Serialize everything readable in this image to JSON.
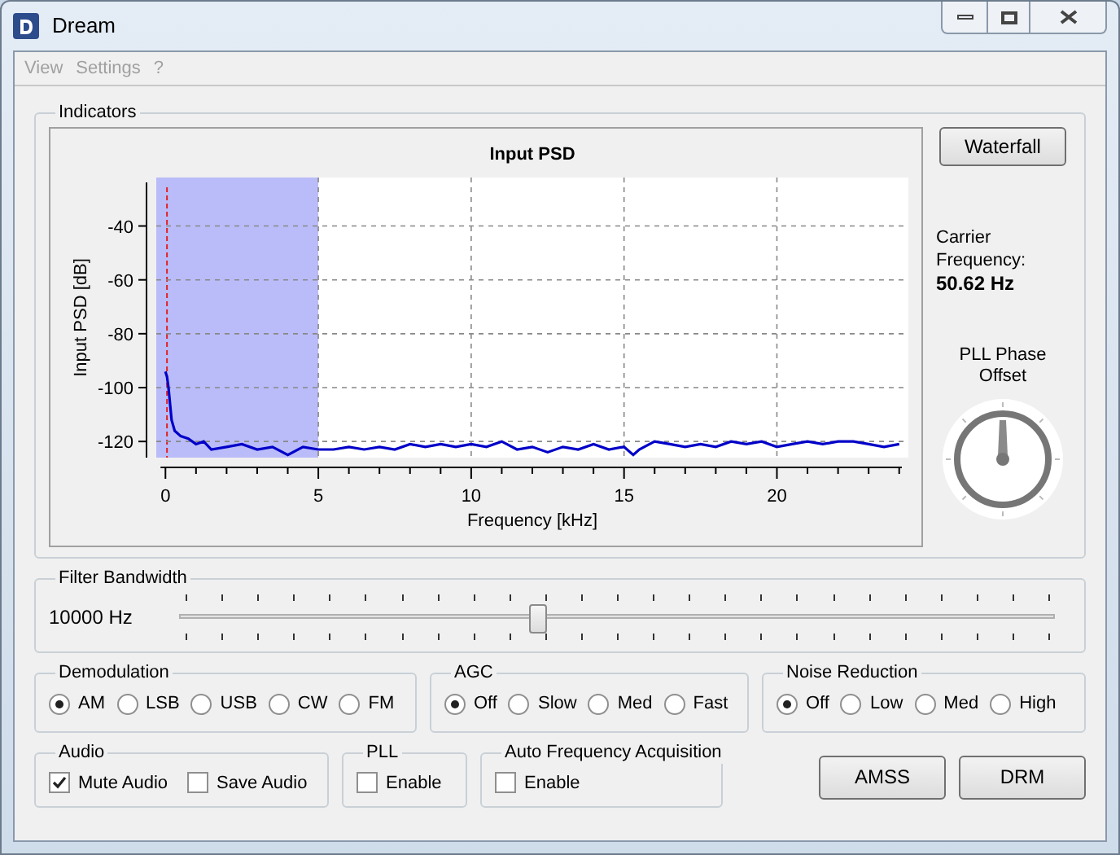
{
  "window": {
    "title": "Dream"
  },
  "menu": [
    {
      "label": "View",
      "disabled": true
    },
    {
      "label": "Settings",
      "disabled": true
    },
    {
      "label": "?",
      "disabled": true
    }
  ],
  "indicators": {
    "label": "Indicators",
    "chart_data": {
      "type": "line",
      "title": "Input PSD",
      "xlabel": "Frequency [kHz]",
      "ylabel": "Input PSD [dB]",
      "xlim": [
        -0.3,
        24.3
      ],
      "ylim": [
        -126,
        -22
      ],
      "xticks": [
        0,
        5,
        10,
        15,
        20
      ],
      "yticks": [
        -40,
        -60,
        -80,
        -100,
        -120
      ],
      "x": [
        0,
        0.05,
        0.1,
        0.2,
        0.3,
        0.5,
        0.75,
        1,
        1.25,
        1.5,
        2,
        2.5,
        3,
        3.5,
        4,
        4.5,
        5,
        5.5,
        6,
        6.5,
        7,
        7.5,
        8,
        8.5,
        9,
        9.5,
        10,
        10.5,
        11,
        11.5,
        12,
        12.5,
        13,
        13.5,
        14,
        14.5,
        15,
        15.3,
        15.5,
        16,
        16.5,
        17,
        17.5,
        18,
        18.5,
        19,
        19.5,
        20,
        20.5,
        21,
        21.5,
        22,
        22.5,
        23,
        23.5,
        24
      ],
      "grid": true,
      "bands": [
        {
          "axis": "x",
          "from": -0.3,
          "to": 5,
          "color": "#babcf9"
        }
      ],
      "ref_lines": [
        {
          "axis": "x",
          "value": 0.05,
          "color": "#e02020"
        }
      ],
      "series": [
        {
          "color": "#0000c8",
          "values": [
            -94,
            -96,
            -100,
            -112,
            -116,
            -118,
            -119,
            -121,
            -120,
            -123,
            -122,
            -121,
            -123,
            -122,
            -125,
            -122,
            -123,
            -123,
            -122,
            -123,
            -122,
            -123,
            -121,
            -122,
            -121,
            -122,
            -121,
            -122,
            -120,
            -123,
            -122,
            -124,
            -122,
            -123,
            -121,
            -123,
            -122,
            -125,
            -123,
            -120,
            -121,
            -122,
            -121,
            -122,
            -120,
            -121,
            -120,
            -122,
            -121,
            -120,
            -121,
            -120,
            -120,
            -121,
            -122,
            -121
          ]
        }
      ]
    },
    "waterfall_button": "Waterfall",
    "carrier_label": "Carrier Frequency:",
    "carrier_value": "50.62 Hz",
    "pll_label": "PLL Phase Offset"
  },
  "filter": {
    "label": "Filter Bandwidth",
    "reading": "10000 Hz",
    "level": 0.41
  },
  "demodulation": {
    "label": "Demodulation",
    "options": [
      {
        "label": "AM",
        "selected": true
      },
      {
        "label": "LSB",
        "selected": false
      },
      {
        "label": "USB",
        "selected": false
      },
      {
        "label": "CW",
        "selected": false
      },
      {
        "label": "FM",
        "selected": false
      }
    ]
  },
  "agc": {
    "label": "AGC",
    "options": [
      {
        "label": "Off",
        "selected": true
      },
      {
        "label": "Slow",
        "selected": false
      },
      {
        "label": "Med",
        "selected": false
      },
      {
        "label": "Fast",
        "selected": false
      }
    ]
  },
  "noise_reduction": {
    "label": "Noise Reduction",
    "options": [
      {
        "label": "Off",
        "selected": true
      },
      {
        "label": "Low",
        "selected": false
      },
      {
        "label": "Med",
        "selected": false
      },
      {
        "label": "High",
        "selected": false
      }
    ]
  },
  "audio": {
    "label": "Audio",
    "options": [
      {
        "label": "Mute Audio",
        "checked": true
      },
      {
        "label": "Save Audio",
        "checked": false
      }
    ]
  },
  "pll": {
    "label": "PLL",
    "options": [
      {
        "label": "Enable",
        "checked": false
      }
    ]
  },
  "afa": {
    "label": "Auto Frequency Acquisition",
    "options": [
      {
        "label": "Enable",
        "checked": false
      }
    ]
  },
  "buttons": [
    "AMSS",
    "DRM"
  ]
}
